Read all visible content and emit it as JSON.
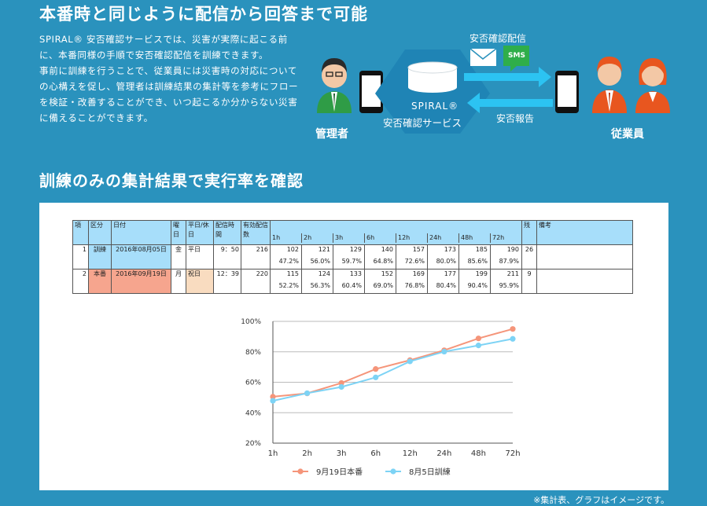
{
  "heading1": "本番時と同じように配信から回答まで可能",
  "description": {
    "para1": "SPIRAL® 安否確認サービスでは、災害が実際に起こる前に、本番同様の手順で安否確認配信を訓練できます。",
    "para2": "事前に訓練を行うことで、従業員には災害時の対応についての心構えを促し、管理者は訓練結果の集計等を参考にフローを検証・改善することができ、いつ起こるか分からない災害に備えることができます。"
  },
  "diagram": {
    "admin_label": "管理者",
    "employees_label": "従業員",
    "service_line1": "SPIRAL®",
    "service_line2": "安否確認サービス",
    "send_label": "安否確認配信",
    "report_label": "安否報告",
    "sms_badge": "SMS",
    "colors": {
      "arrow": "#2cc3f2",
      "service_bg": "#1f84b5",
      "green": "#2fae4a",
      "orange": "#e8561f"
    }
  },
  "heading2": "訓練のみの集計結果で実行率を確認",
  "table": {
    "headers": {
      "item": "項",
      "type": "区分",
      "date": "日付",
      "weekday": "曜日",
      "daytype": "平日/休日",
      "time": "配信時間",
      "count": "有効配信数",
      "hours": [
        "1h",
        "2h",
        "3h",
        "6h",
        "12h",
        "24h",
        "48h",
        "72h"
      ],
      "remain": "残",
      "note": "備考"
    },
    "rows": [
      {
        "no": "1",
        "type": "訓練",
        "date": "2016年08月05日",
        "weekday": "金",
        "daytype": "平日",
        "time": "9：50",
        "count": "216",
        "values": [
          "102",
          "121",
          "129",
          "140",
          "157",
          "173",
          "185",
          "190"
        ],
        "rates": [
          "47.2%",
          "56.0%",
          "59.7%",
          "64.8%",
          "72.6%",
          "80.0%",
          "85.6%",
          "87.9%"
        ],
        "remain": "26",
        "note": ""
      },
      {
        "no": "2",
        "type": "本番",
        "date": "2016年09月19日",
        "weekday": "月",
        "daytype": "祝日",
        "time": "12：39",
        "count": "220",
        "values": [
          "115",
          "124",
          "133",
          "152",
          "169",
          "177",
          "199",
          "211"
        ],
        "rates": [
          "52.2%",
          "56.3%",
          "60.4%",
          "69.0%",
          "76.8%",
          "80.4%",
          "90.4%",
          "95.9%"
        ],
        "remain": "9",
        "note": ""
      }
    ]
  },
  "chart_data": {
    "type": "line",
    "categories": [
      "1h",
      "2h",
      "3h",
      "6h",
      "12h",
      "24h",
      "48h",
      "72h"
    ],
    "series": [
      {
        "name": "9月19日本番",
        "values": [
          50.5,
          52.7,
          59.5,
          68.7,
          74.5,
          81.0,
          88.8,
          95.0
        ],
        "color": "#f5957a"
      },
      {
        "name": "8月5日訓練",
        "values": [
          47.8,
          52.8,
          56.9,
          63.2,
          73.7,
          80.1,
          84.2,
          88.5
        ],
        "color": "#7dd3f5"
      }
    ],
    "yticks": [
      "20%",
      "40%",
      "60%",
      "80%",
      "100%"
    ],
    "ylim": [
      20,
      100
    ],
    "grid": true,
    "legend": "bottom"
  },
  "footnote": "※集計表、グラフはイメージです。"
}
